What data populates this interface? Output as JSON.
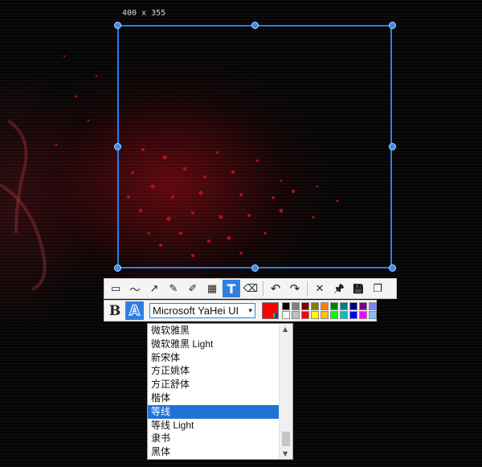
{
  "selection": {
    "size_label": "400 x 355"
  },
  "toolbar": {
    "tools": [
      {
        "name": "rectangle-tool",
        "icon": "rect-icon",
        "glyph": "▭",
        "active": false
      },
      {
        "name": "freehand-tool",
        "icon": "wave-icon",
        "glyph": "〜",
        "active": false
      },
      {
        "name": "arrow-tool",
        "icon": "arrow-icon",
        "glyph": "↗",
        "active": false
      },
      {
        "name": "pen-tool",
        "icon": "pencil-icon",
        "glyph": "✎",
        "active": false
      },
      {
        "name": "marker-tool",
        "icon": "highlighter-icon",
        "glyph": "✐",
        "active": false
      },
      {
        "name": "mosaic-tool",
        "icon": "mosaic-icon",
        "glyph": "▦",
        "active": false
      },
      {
        "name": "text-tool",
        "icon": "text-icon",
        "glyph": "T",
        "active": true
      },
      {
        "name": "eraser-tool",
        "icon": "eraser-icon",
        "glyph": "⌫",
        "active": false
      }
    ],
    "actions": [
      {
        "name": "undo-button",
        "icon": "undo-icon",
        "glyph": "↶"
      },
      {
        "name": "redo-button",
        "icon": "redo-icon",
        "glyph": "↷"
      }
    ],
    "finish": [
      {
        "name": "cancel-button",
        "icon": "close-icon",
        "glyph": "✕"
      },
      {
        "name": "pin-button",
        "icon": "pin-icon",
        "glyph": "📌"
      },
      {
        "name": "save-button",
        "icon": "save-icon",
        "glyph": "💾"
      },
      {
        "name": "copy-button",
        "icon": "copy-icon",
        "glyph": "❐"
      }
    ]
  },
  "textbar": {
    "bold_label": "B",
    "outline_label": "A",
    "font_value": "Microsoft YaHei UI",
    "caret": "▾",
    "current_color": "#ff0000"
  },
  "palette": [
    "#000000",
    "#808080",
    "#800000",
    "#808000",
    "#ff8000",
    "#008000",
    "#008080",
    "#000080",
    "#800080",
    "#8080ff",
    "#ffffff",
    "#c0c0c0",
    "#ff0000",
    "#ffff00",
    "#ffc000",
    "#00ff00",
    "#00c0c0",
    "#0000ff",
    "#ff00ff",
    "#80c0ff"
  ],
  "font_list": {
    "items": [
      "微软雅黑",
      "微软雅黑 Light",
      "新宋体",
      "方正姚体",
      "方正舒体",
      "楷体",
      "等线",
      "等线 Light",
      "隶书",
      "黑体"
    ],
    "selected_index": 6
  },
  "colors": {
    "accent": "#2f7fe0",
    "selected_row": "#1f73d6"
  }
}
